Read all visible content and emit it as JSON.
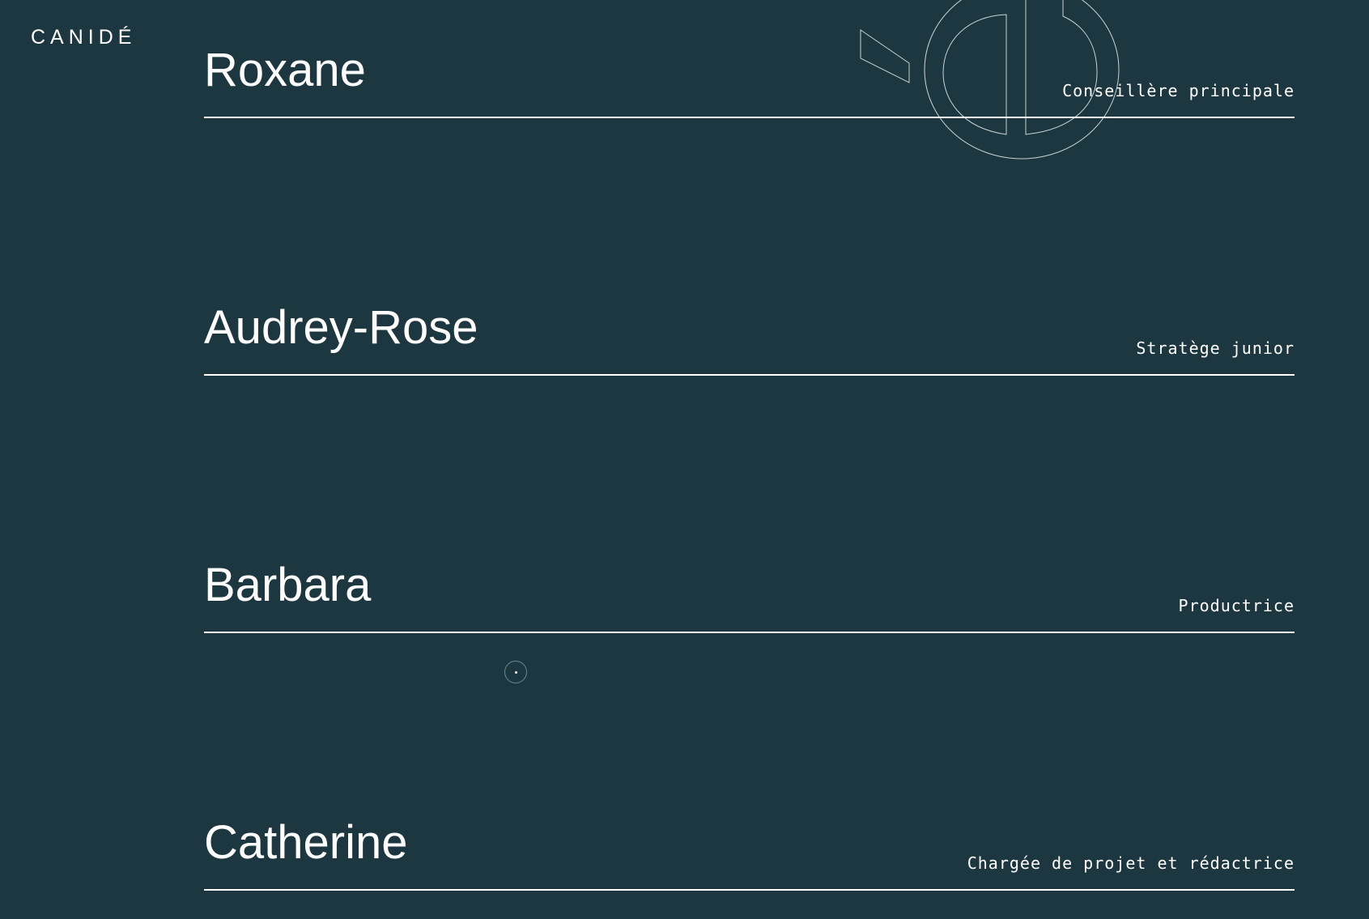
{
  "brand": {
    "logo_text": "CANIDÉ"
  },
  "team": [
    {
      "name": "Roxane",
      "role": "Conseillère principale"
    },
    {
      "name": "Audrey-Rose",
      "role": "Stratège junior"
    },
    {
      "name": "Barbara",
      "role": "Productrice"
    },
    {
      "name": "Catherine",
      "role": "Chargée de projet et rédactrice"
    }
  ],
  "decoration": {
    "icon": "canide-monogram-outline"
  },
  "cursor": {
    "icon": "custom-cursor-circle"
  },
  "colors": {
    "background": "#1c373f",
    "text": "#ffffff",
    "outline": "#c9d3d3"
  }
}
